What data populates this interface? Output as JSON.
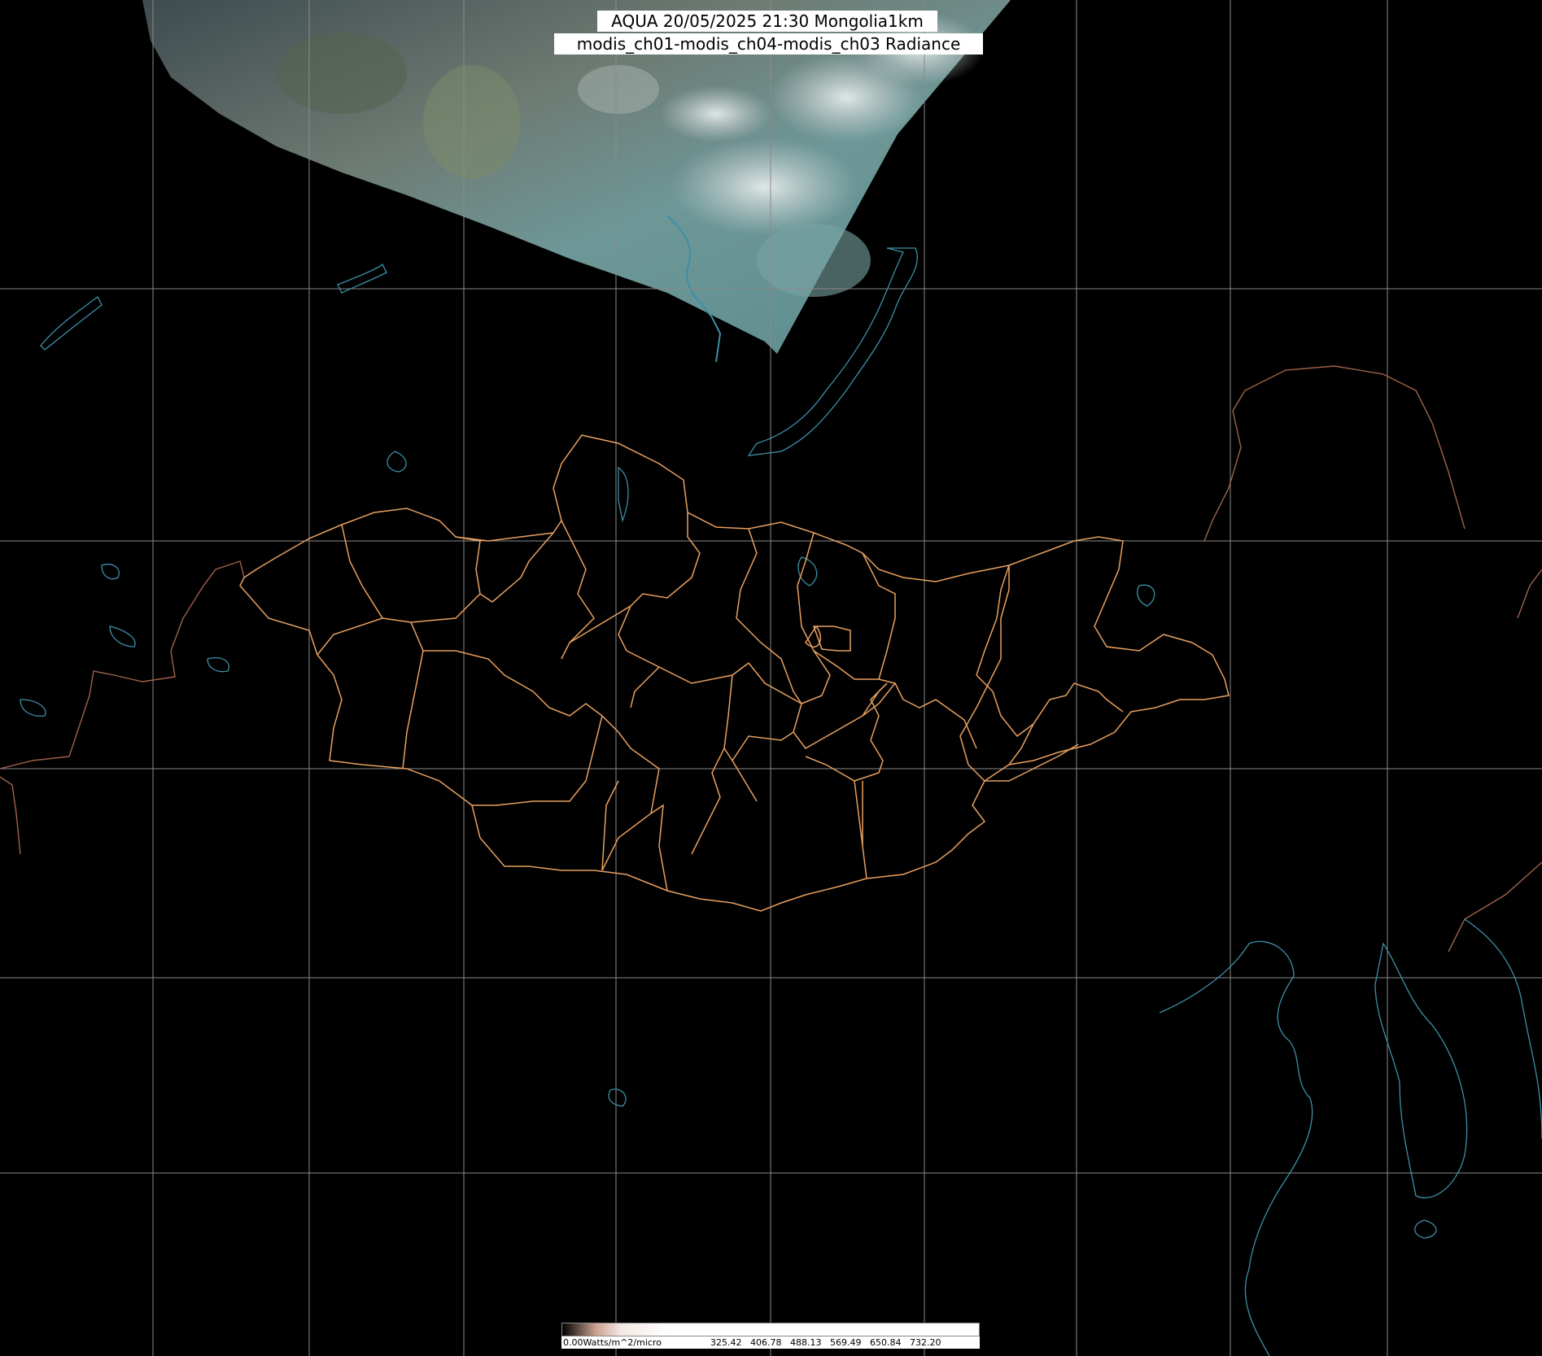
{
  "title": {
    "line1": "AQUA 20/05/2025 21:30 Mongolia1km",
    "line2": "modis_ch01-modis_ch04-modis_ch03 Radiance"
  },
  "colorbar": {
    "unit_label": "0.00Watts/m^2/micro",
    "ticks": [
      "325.42",
      "406.78",
      "488.13",
      "569.49",
      "650.84",
      "732.20"
    ]
  },
  "colors": {
    "background": "#000000",
    "grid": "#8a8a8a",
    "province_border": "#e8a060",
    "coastline": "#3d8fa8",
    "country_border": "#a0624a",
    "imagery_water": "#5f8f96",
    "imagery_cloud": "#c9d1d1"
  }
}
